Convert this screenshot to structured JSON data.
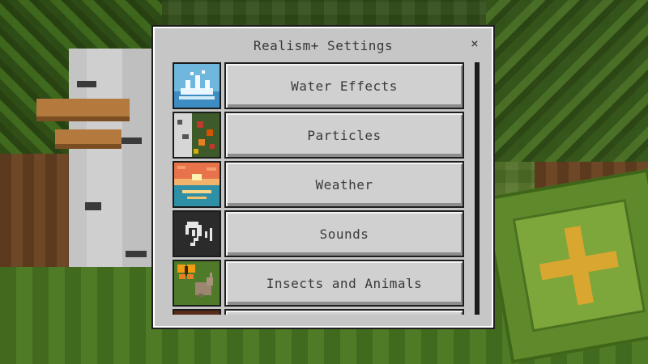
{
  "dialog": {
    "title": "Realism+ Settings",
    "close_label": "×"
  },
  "menu": {
    "items": [
      {
        "label": "Water Effects",
        "icon": "water-splash-icon"
      },
      {
        "label": "Particles",
        "icon": "particles-icon"
      },
      {
        "label": "Weather",
        "icon": "sunset-weather-icon"
      },
      {
        "label": "Sounds",
        "icon": "ear-sound-icon"
      },
      {
        "label": "Insects and Animals",
        "icon": "butterfly-rabbit-icon"
      }
    ]
  },
  "colors": {
    "dialog_bg": "#c6c6c6",
    "button_bg": "#d0d0d0",
    "text": "#3a3a3a"
  }
}
